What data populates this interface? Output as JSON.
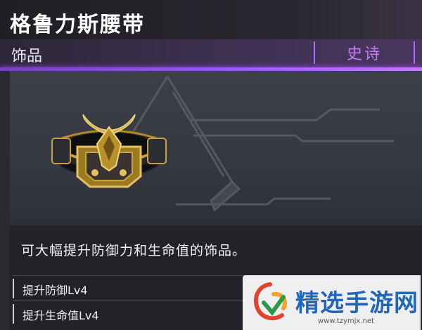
{
  "item": {
    "name": "格鲁力斯腰带",
    "category": "饰品",
    "rarity": "史诗",
    "description": "可大幅提升防御力和生命值的饰品。",
    "stats": [
      "提升防御Lv4",
      "提升生命值Lv4"
    ]
  },
  "watermark": {
    "brand": "精选手游网",
    "url": "www.tzymjx.net"
  },
  "colors": {
    "rarity_epic": "#b267ff",
    "watermark_blue": "#2366b6"
  }
}
